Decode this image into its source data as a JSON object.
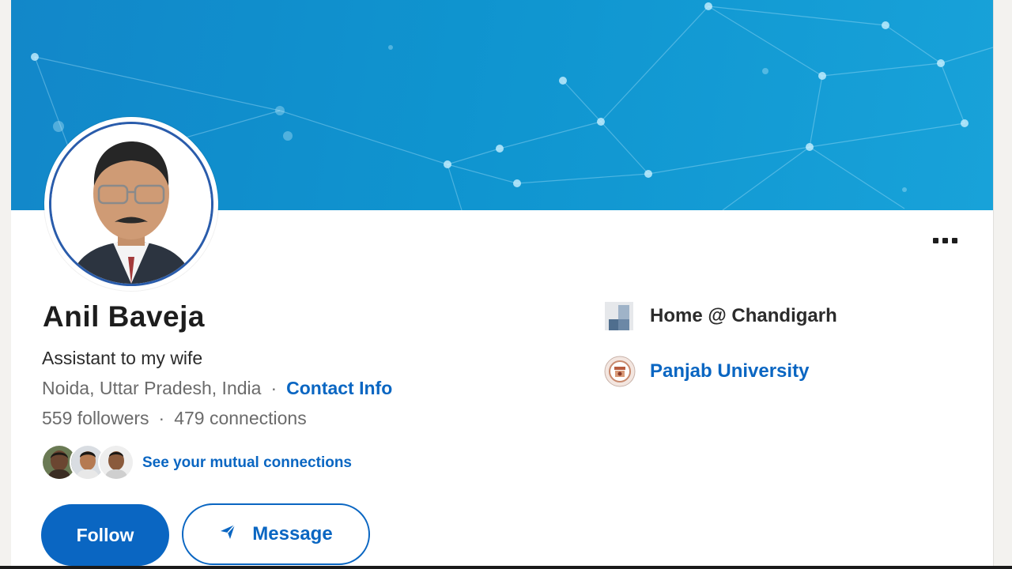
{
  "profile": {
    "name": "Anil Baveja",
    "headline": "Assistant to my wife",
    "location": "Noida, Uttar Pradesh, India",
    "separator": "·",
    "contact_info_label": "Contact Info",
    "followers": "559 followers",
    "connections": "479 connections",
    "mutual_connections_label": "See your mutual connections"
  },
  "actions": {
    "follow_label": "Follow",
    "message_label": "Message",
    "more_icon": "more-horizontal-icon"
  },
  "experience": {
    "company": "Home @ Chandigarh"
  },
  "education": {
    "school": "Panjab University"
  },
  "colors": {
    "accent": "#0a66c2",
    "banner": "#1390cc",
    "avatar_ring": "#2a5cab"
  }
}
